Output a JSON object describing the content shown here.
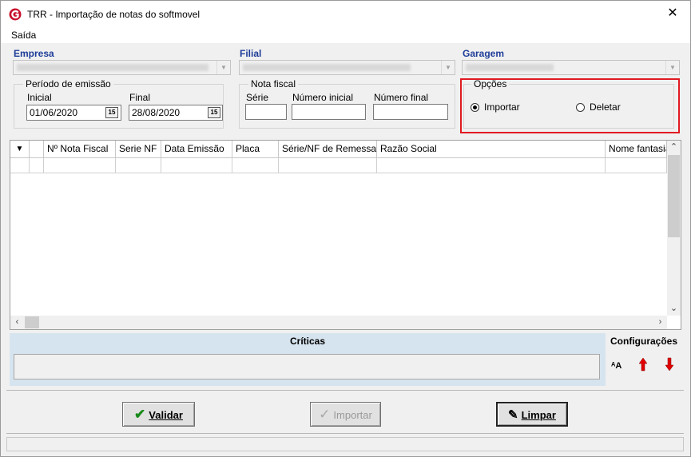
{
  "window": {
    "title": "TRR - Importação de notas do softmovel",
    "close_glyph": "✕"
  },
  "menu": {
    "items": [
      "Saída"
    ]
  },
  "filters": {
    "empresa_label": "Empresa",
    "filial_label": "Filial",
    "garagem_label": "Garagem"
  },
  "periodo": {
    "legend": "Período de emissão",
    "inicial_label": "Inicial",
    "inicial_value": "01/06/2020",
    "final_label": "Final",
    "final_value": "28/08/2020",
    "cal_glyph": "15"
  },
  "nota": {
    "legend": "Nota fiscal",
    "serie_label": "Série",
    "numero_inicial_label": "Número inicial",
    "numero_final_label": "Número final"
  },
  "opcoes": {
    "legend": "Opções",
    "importar_label": "Importar",
    "deletar_label": "Deletar",
    "selected": "Importar"
  },
  "grid": {
    "columns": [
      "Nº Nota Fiscal",
      "Serie NF",
      "Data Emissão",
      "Placa",
      "Série/NF de Remessa",
      "Razão Social",
      "Nome fantasia"
    ]
  },
  "criticas": {
    "title": "Críticas"
  },
  "config": {
    "title": "Configurações"
  },
  "actions": {
    "validar": "Validar",
    "importar": "Importar",
    "limpar": "Limpar"
  },
  "colors": {
    "highlight": "#e11a22",
    "group_label": "#1f3d99",
    "check_green": "#1a8a1a"
  }
}
